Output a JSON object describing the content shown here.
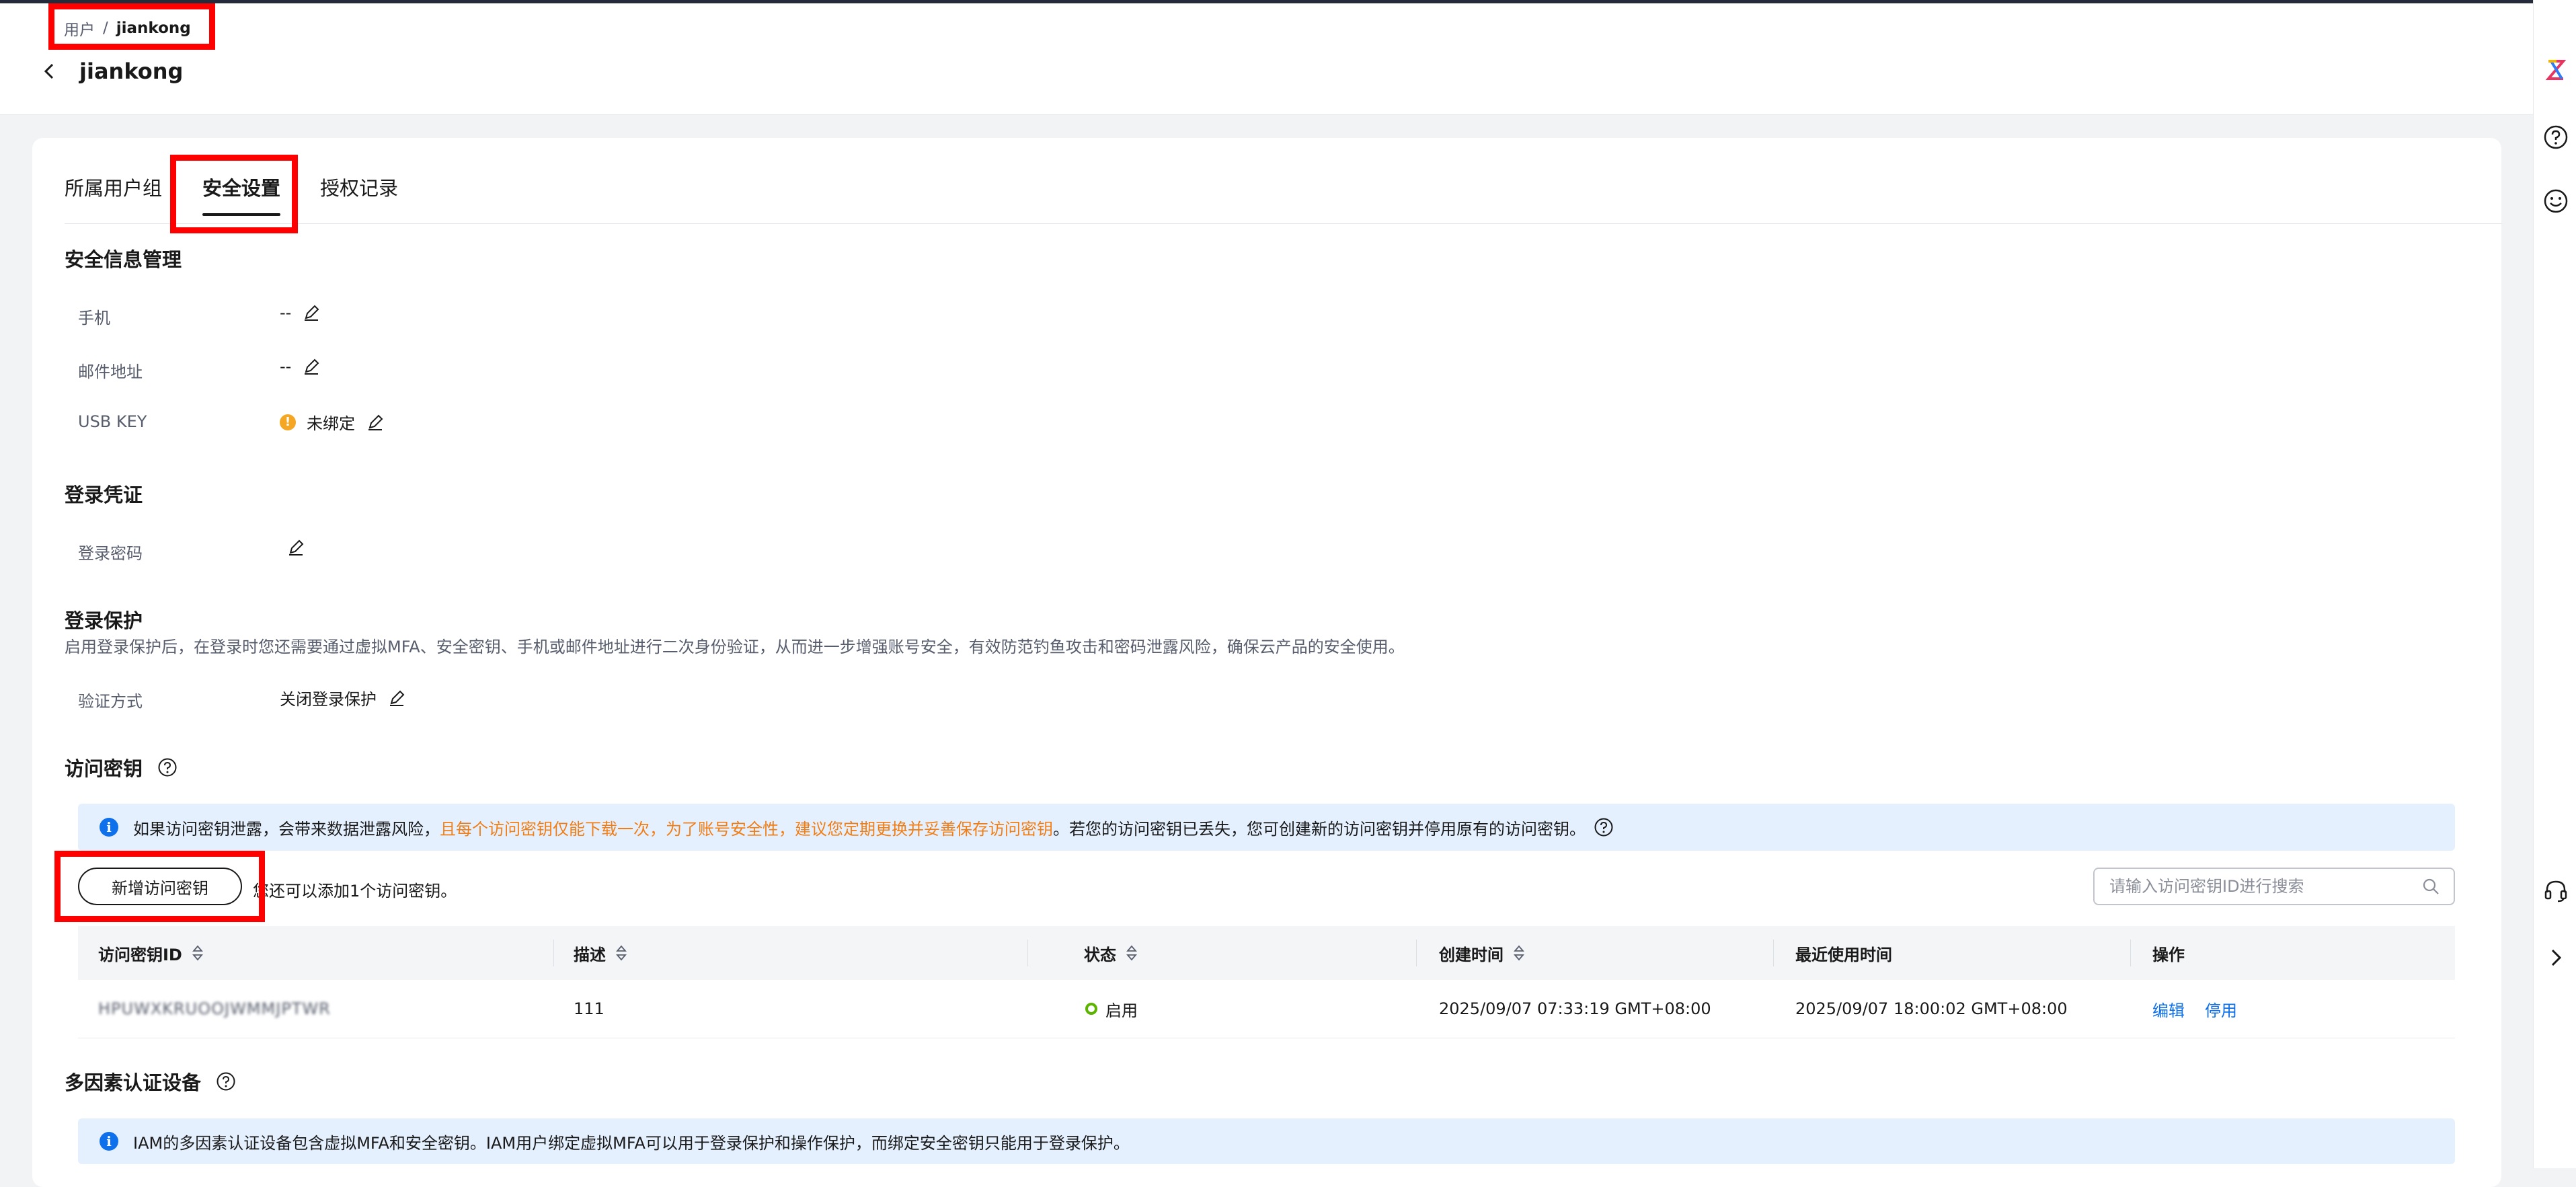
{
  "breadcrumb": {
    "parent": "用户",
    "separator": "/",
    "current": "jiankong"
  },
  "page": {
    "title": "jiankong"
  },
  "tabs": [
    {
      "label": "所属用户组"
    },
    {
      "label": "安全设置"
    },
    {
      "label": "授权记录"
    }
  ],
  "security_info": {
    "title": "安全信息管理",
    "phone_label": "手机",
    "phone_value": "--",
    "email_label": "邮件地址",
    "email_value": "--",
    "usbkey_label": "USB KEY",
    "usbkey_value": "未绑定"
  },
  "login_credential": {
    "title": "登录凭证",
    "password_label": "登录密码"
  },
  "login_protection": {
    "title": "登录保护",
    "description": "启用登录保护后，在登录时您还需要通过虚拟MFA、安全密钥、手机或邮件地址进行二次身份验证，从而进一步增强账号安全，有效防范钓鱼攻击和密码泄露风险，确保云产品的安全使用。",
    "method_label": "验证方式",
    "method_value": "关闭登录保护"
  },
  "access_keys": {
    "title": "访问密钥",
    "info_prefix": "如果访问密钥泄露，会带来数据泄露风险，",
    "info_highlight": "且每个访问密钥仅能下载一次，为了账号安全性，建议您定期更换并妥善保存访问密钥",
    "info_suffix": "。若您的访问密钥已丢失，您可创建新的访问密钥并停用原有的访问密钥。",
    "add_button": "新增访问密钥",
    "add_hint": "您还可以添加1个访问密钥。",
    "search_placeholder": "请输入访问密钥ID进行搜索",
    "columns": [
      "访问密钥ID",
      "描述",
      "状态",
      "创建时间",
      "最近使用时间",
      "操作"
    ],
    "rows": [
      {
        "id": "HPUWXKRUOOJWMMJPTWR",
        "description": "111",
        "status": "启用",
        "created": "2025/09/07 07:33:19 GMT+08:00",
        "last_used": "2025/09/07 18:00:02 GMT+08:00",
        "action_edit": "编辑",
        "action_disable": "停用"
      }
    ]
  },
  "mfa": {
    "title": "多因素认证设备",
    "info": "IAM的多因素认证设备包含虚拟MFA和安全密钥。IAM用户绑定虚拟MFA可以用于登录保护和操作保护，而绑定安全密钥只能用于登录保护。"
  },
  "colors": {
    "accent": "#0e70eb",
    "warning": "#f5a623",
    "highlight": "#f27e13",
    "annotation": "#ff0000",
    "status_ok": "#5cb300"
  },
  "icons": [
    "back-arrow-icon",
    "edit-icon",
    "warning-icon",
    "help-icon",
    "info-icon",
    "sort-icon",
    "search-icon",
    "brand-logo-icon",
    "question-circle-icon",
    "smile-icon",
    "headset-icon",
    "chevron-right-icon"
  ]
}
